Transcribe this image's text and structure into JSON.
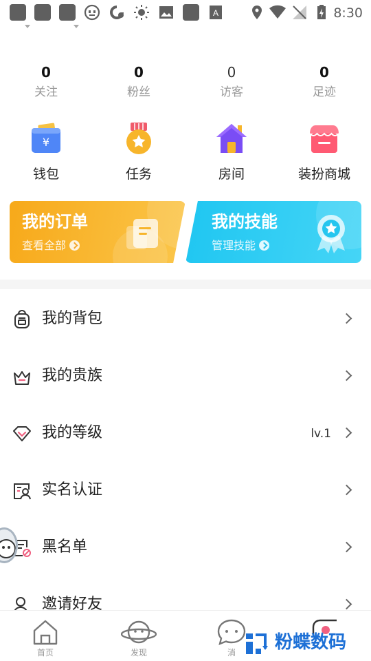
{
  "status_bar": {
    "time": "8:30",
    "icons": [
      "notification-square-icon",
      "notification-square-icon",
      "notification-square-icon",
      "face-icon",
      "refresh-icon",
      "brightness-icon",
      "image-icon",
      "notification-square-icon",
      "font-icon",
      "location-icon",
      "wifi-icon",
      "no-signal-icon",
      "battery-charging-icon"
    ]
  },
  "stats": [
    {
      "value": "0",
      "label": "关注"
    },
    {
      "value": "0",
      "label": "粉丝"
    },
    {
      "value": "0",
      "label": "访客"
    },
    {
      "value": "0",
      "label": "足迹"
    }
  ],
  "quick_actions": [
    {
      "label": "钱包",
      "icon": "wallet-icon"
    },
    {
      "label": "任务",
      "icon": "medal-icon"
    },
    {
      "label": "房间",
      "icon": "house-icon"
    },
    {
      "label": "装扮商城",
      "icon": "shop-icon"
    }
  ],
  "cards": {
    "orders": {
      "title": "我的订单",
      "sub": "查看全部"
    },
    "skills": {
      "title": "我的技能",
      "sub": "管理技能"
    }
  },
  "menu": [
    {
      "label": "我的背包",
      "icon": "backpack-icon",
      "extra": ""
    },
    {
      "label": "我的贵族",
      "icon": "crown-icon",
      "extra": ""
    },
    {
      "label": "我的等级",
      "icon": "diamond-icon",
      "extra": "lv.1"
    },
    {
      "label": "实名认证",
      "icon": "id-card-icon",
      "extra": ""
    },
    {
      "label": "黑名单",
      "icon": "blocklist-icon",
      "extra": ""
    },
    {
      "label": "邀请好友",
      "icon": "person-icon",
      "extra": ""
    }
  ],
  "bottom_nav": [
    {
      "label": "首页",
      "icon": "home-icon"
    },
    {
      "label": "发现",
      "icon": "planet-icon"
    },
    {
      "label": "消",
      "icon": "message-icon"
    }
  ],
  "watermark": {
    "text": "粉蝶数码"
  },
  "colors": {
    "orange_card": "#f7a91a",
    "blue_card": "#1fc6f1",
    "watermark": "#1d70d6",
    "status_icons": "#5f5f5f"
  }
}
